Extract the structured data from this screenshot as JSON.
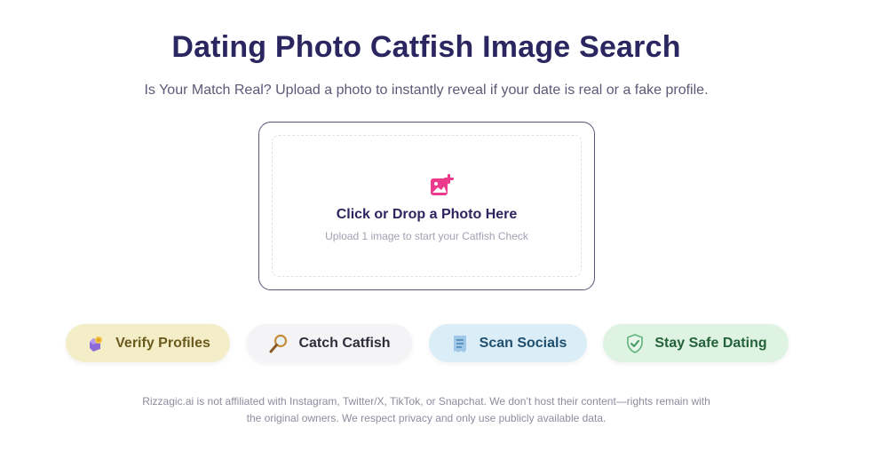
{
  "header": {
    "title": "Dating Photo Catfish Image Search",
    "subtitle": "Is Your Match Real? Upload a photo to instantly reveal if your date is real or a fake profile."
  },
  "upload": {
    "icon": "image-add-icon",
    "title": "Click or Drop a Photo Here",
    "hint": "Upload 1 image to start your Catfish Check"
  },
  "features": [
    {
      "label": "Verify Profiles",
      "icon": "user-badge-icon",
      "color": "#f4eec8"
    },
    {
      "label": "Catch Catfish",
      "icon": "magnifier-icon",
      "color": "#f4f4f6"
    },
    {
      "label": "Scan Socials",
      "icon": "document-scan-icon",
      "color": "#dbeef7"
    },
    {
      "label": "Stay Safe Dating",
      "icon": "shield-check-icon",
      "color": "#dff3e2"
    }
  ],
  "disclaimer": "Rizzagic.ai is not affiliated with Instagram, Twitter/X, TikTok, or Snapchat. We don’t host their content—rights remain with the original owners. We respect privacy and only use publicly available data.",
  "colors": {
    "accent_pink": "#ec3b8c",
    "title_navy": "#2b2560"
  }
}
